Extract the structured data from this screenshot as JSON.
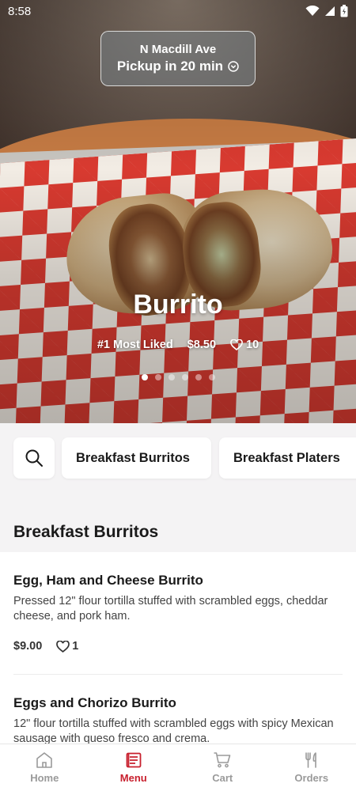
{
  "status_bar": {
    "time": "8:58"
  },
  "location": {
    "street": "N Macdill Ave",
    "pickup": "Pickup in 20 min"
  },
  "hero": {
    "title": "Burrito",
    "badge": "#1 Most Liked",
    "price": "$8.50",
    "likes": "10",
    "carousel_count": 6,
    "carousel_active": 0
  },
  "categories": [
    "Breakfast Burritos",
    "Breakfast Platers"
  ],
  "section": {
    "title": "Breakfast Burritos"
  },
  "items": [
    {
      "name": "Egg, Ham and Cheese Burrito",
      "description": "Pressed 12\" flour tortilla stuffed with scrambled eggs, cheddar cheese, and pork ham.",
      "price": "$9.00",
      "likes": "1"
    },
    {
      "name": "Eggs and Chorizo Burrito",
      "description": "12\" flour tortilla stuffed with scrambled eggs with spicy Mexican sausage with queso fresco and crema."
    }
  ],
  "nav": {
    "items": [
      {
        "label": "Home",
        "icon": "home-icon"
      },
      {
        "label": "Menu",
        "icon": "menu-icon"
      },
      {
        "label": "Cart",
        "icon": "cart-icon"
      },
      {
        "label": "Orders",
        "icon": "fork-knife-icon"
      }
    ],
    "active_color": "#c8202e",
    "inactive_color": "#9a9a9a"
  }
}
